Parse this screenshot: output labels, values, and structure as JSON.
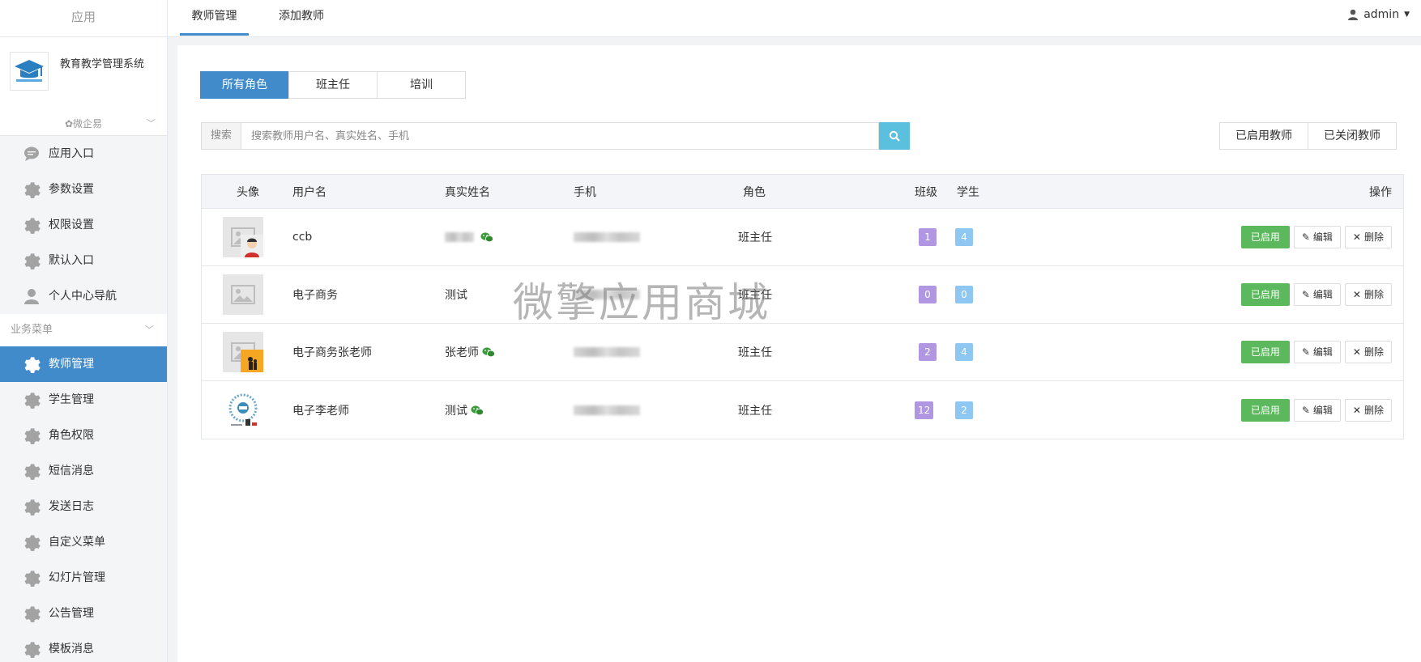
{
  "sidebar": {
    "top_label": "应用",
    "brand_name": "教育教学管理系统",
    "sub_label": "微企易",
    "group1": [
      {
        "label": "应用入口",
        "icon": "chat-bubble-icon"
      },
      {
        "label": "参数设置",
        "icon": "gear-icon"
      },
      {
        "label": "权限设置",
        "icon": "gear-icon"
      },
      {
        "label": "默认入口",
        "icon": "gear-icon"
      },
      {
        "label": "个人中心导航",
        "icon": "user-icon"
      }
    ],
    "section_label": "业务菜单",
    "group2": [
      {
        "label": "教师管理",
        "icon": "gear-icon",
        "active": true
      },
      {
        "label": "学生管理",
        "icon": "gear-icon"
      },
      {
        "label": "角色权限",
        "icon": "gear-icon"
      },
      {
        "label": "短信消息",
        "icon": "gear-icon"
      },
      {
        "label": "发送日志",
        "icon": "gear-icon"
      },
      {
        "label": "自定义菜单",
        "icon": "gear-icon"
      },
      {
        "label": "幻灯片管理",
        "icon": "gear-icon"
      },
      {
        "label": "公告管理",
        "icon": "gear-icon"
      },
      {
        "label": "模板消息",
        "icon": "gear-icon"
      }
    ]
  },
  "topnav": {
    "tabs": [
      {
        "label": "教师管理",
        "active": true
      },
      {
        "label": "添加教师",
        "active": false
      }
    ],
    "user": "admin"
  },
  "role_tabs": [
    "所有角色",
    "班主任",
    "培训"
  ],
  "search": {
    "addon": "搜索",
    "placeholder": "搜索教师用户名、真实姓名、手机"
  },
  "filters": [
    "已启用教师",
    "已关闭教师"
  ],
  "table": {
    "headers": {
      "avatar": "头像",
      "username": "用户名",
      "realname": "真实姓名",
      "phone": "手机",
      "role": "角色",
      "class": "班级",
      "student": "学生",
      "ops": "操作"
    },
    "rows": [
      {
        "username": "ccb",
        "realname": "",
        "wechat": true,
        "role": "班主任",
        "class": "1",
        "student": "4"
      },
      {
        "username": "电子商务",
        "realname": "测试",
        "wechat": false,
        "role": "班主任",
        "class": "0",
        "student": "0"
      },
      {
        "username": "电子商务张老师",
        "realname": "张老师",
        "wechat": true,
        "role": "班主任",
        "class": "2",
        "student": "4"
      },
      {
        "username": "电子李老师",
        "realname": "测试",
        "wechat": true,
        "role": "班主任",
        "class": "12",
        "student": "2"
      }
    ],
    "actions": {
      "enabled": "已启用",
      "edit": "编辑",
      "delete": "删除"
    }
  },
  "watermark": "微擎应用商城",
  "colors": {
    "primary": "#428bca",
    "success": "#5cb85c",
    "info": "#5bc0de",
    "badge_purple": "#b196e1",
    "badge_blue": "#8ec7f2"
  }
}
